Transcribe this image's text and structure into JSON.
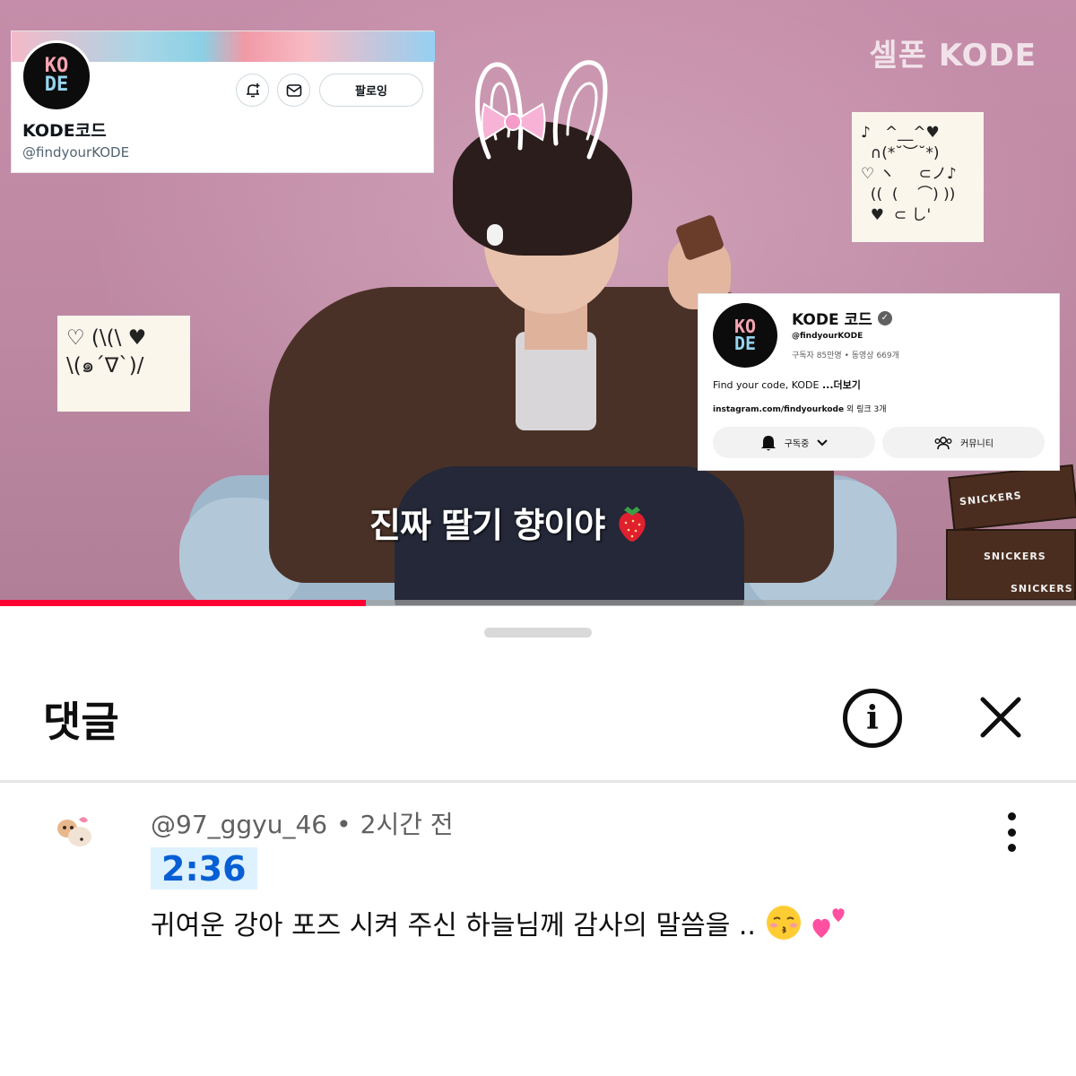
{
  "video": {
    "watermark": "셀폰 KODE",
    "subtitle": "진짜 딸기 향이야",
    "progress_fraction": 0.34,
    "kaomoji_top_right": "♪   ^__^♥\n  ∩(*˘︶˘*)\n♡ ヽ     ⊂ノ♪\n  ((  (    ⌒) ))\n  ♥  ⊂ し'",
    "kaomoji_left": "♡ (\\(\\ ♥\n\\(๑´∇`)/",
    "snickers_label": "SNICKERS"
  },
  "x_profile": {
    "name": "KODE코드",
    "handle": "@findyourKODE",
    "follow_label": "팔로잉",
    "logo_line1": "KO",
    "logo_line2": "DE"
  },
  "yt_channel": {
    "name": "KODE 코드",
    "handle": "@findyourKODE",
    "stats": "구독자 85만명 • 동영상 669개",
    "description": "Find your code, KODE",
    "more": "...더보기",
    "link": "instagram.com/findyourkode",
    "link_suffix": "외 링크 3개",
    "subscribe_label": "구독중",
    "community_label": "커뮤니티"
  },
  "comments_sheet": {
    "title": "댓글",
    "comment": {
      "author": "@97_ggyu_46",
      "time": "2시간 전",
      "timestamp": "2:36",
      "text": "귀여운 강아 포즈 시켜 주신 하늘님께 감사의 말씀을 .."
    }
  },
  "colors": {
    "accent_red": "#ff0033",
    "timestamp_bg": "#def1ff",
    "timestamp_text": "#065fd4",
    "logo_pink": "#f6a4b2",
    "logo_blue": "#96d4ef"
  }
}
